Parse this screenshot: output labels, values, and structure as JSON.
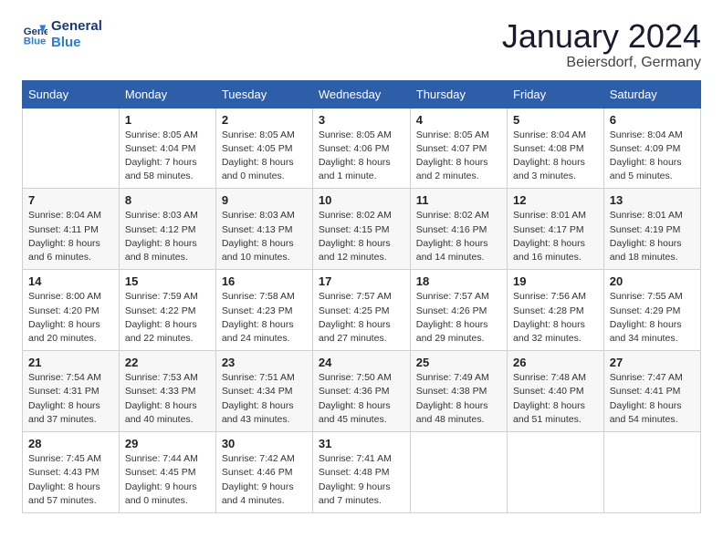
{
  "header": {
    "logo_line1": "General",
    "logo_line2": "Blue",
    "month": "January 2024",
    "location": "Beiersdorf, Germany"
  },
  "days_of_week": [
    "Sunday",
    "Monday",
    "Tuesday",
    "Wednesday",
    "Thursday",
    "Friday",
    "Saturday"
  ],
  "weeks": [
    [
      {
        "day": "",
        "info": ""
      },
      {
        "day": "1",
        "info": "Sunrise: 8:05 AM\nSunset: 4:04 PM\nDaylight: 7 hours\nand 58 minutes."
      },
      {
        "day": "2",
        "info": "Sunrise: 8:05 AM\nSunset: 4:05 PM\nDaylight: 8 hours\nand 0 minutes."
      },
      {
        "day": "3",
        "info": "Sunrise: 8:05 AM\nSunset: 4:06 PM\nDaylight: 8 hours\nand 1 minute."
      },
      {
        "day": "4",
        "info": "Sunrise: 8:05 AM\nSunset: 4:07 PM\nDaylight: 8 hours\nand 2 minutes."
      },
      {
        "day": "5",
        "info": "Sunrise: 8:04 AM\nSunset: 4:08 PM\nDaylight: 8 hours\nand 3 minutes."
      },
      {
        "day": "6",
        "info": "Sunrise: 8:04 AM\nSunset: 4:09 PM\nDaylight: 8 hours\nand 5 minutes."
      }
    ],
    [
      {
        "day": "7",
        "info": "Sunrise: 8:04 AM\nSunset: 4:11 PM\nDaylight: 8 hours\nand 6 minutes."
      },
      {
        "day": "8",
        "info": "Sunrise: 8:03 AM\nSunset: 4:12 PM\nDaylight: 8 hours\nand 8 minutes."
      },
      {
        "day": "9",
        "info": "Sunrise: 8:03 AM\nSunset: 4:13 PM\nDaylight: 8 hours\nand 10 minutes."
      },
      {
        "day": "10",
        "info": "Sunrise: 8:02 AM\nSunset: 4:15 PM\nDaylight: 8 hours\nand 12 minutes."
      },
      {
        "day": "11",
        "info": "Sunrise: 8:02 AM\nSunset: 4:16 PM\nDaylight: 8 hours\nand 14 minutes."
      },
      {
        "day": "12",
        "info": "Sunrise: 8:01 AM\nSunset: 4:17 PM\nDaylight: 8 hours\nand 16 minutes."
      },
      {
        "day": "13",
        "info": "Sunrise: 8:01 AM\nSunset: 4:19 PM\nDaylight: 8 hours\nand 18 minutes."
      }
    ],
    [
      {
        "day": "14",
        "info": "Sunrise: 8:00 AM\nSunset: 4:20 PM\nDaylight: 8 hours\nand 20 minutes."
      },
      {
        "day": "15",
        "info": "Sunrise: 7:59 AM\nSunset: 4:22 PM\nDaylight: 8 hours\nand 22 minutes."
      },
      {
        "day": "16",
        "info": "Sunrise: 7:58 AM\nSunset: 4:23 PM\nDaylight: 8 hours\nand 24 minutes."
      },
      {
        "day": "17",
        "info": "Sunrise: 7:57 AM\nSunset: 4:25 PM\nDaylight: 8 hours\nand 27 minutes."
      },
      {
        "day": "18",
        "info": "Sunrise: 7:57 AM\nSunset: 4:26 PM\nDaylight: 8 hours\nand 29 minutes."
      },
      {
        "day": "19",
        "info": "Sunrise: 7:56 AM\nSunset: 4:28 PM\nDaylight: 8 hours\nand 32 minutes."
      },
      {
        "day": "20",
        "info": "Sunrise: 7:55 AM\nSunset: 4:29 PM\nDaylight: 8 hours\nand 34 minutes."
      }
    ],
    [
      {
        "day": "21",
        "info": "Sunrise: 7:54 AM\nSunset: 4:31 PM\nDaylight: 8 hours\nand 37 minutes."
      },
      {
        "day": "22",
        "info": "Sunrise: 7:53 AM\nSunset: 4:33 PM\nDaylight: 8 hours\nand 40 minutes."
      },
      {
        "day": "23",
        "info": "Sunrise: 7:51 AM\nSunset: 4:34 PM\nDaylight: 8 hours\nand 43 minutes."
      },
      {
        "day": "24",
        "info": "Sunrise: 7:50 AM\nSunset: 4:36 PM\nDaylight: 8 hours\nand 45 minutes."
      },
      {
        "day": "25",
        "info": "Sunrise: 7:49 AM\nSunset: 4:38 PM\nDaylight: 8 hours\nand 48 minutes."
      },
      {
        "day": "26",
        "info": "Sunrise: 7:48 AM\nSunset: 4:40 PM\nDaylight: 8 hours\nand 51 minutes."
      },
      {
        "day": "27",
        "info": "Sunrise: 7:47 AM\nSunset: 4:41 PM\nDaylight: 8 hours\nand 54 minutes."
      }
    ],
    [
      {
        "day": "28",
        "info": "Sunrise: 7:45 AM\nSunset: 4:43 PM\nDaylight: 8 hours\nand 57 minutes."
      },
      {
        "day": "29",
        "info": "Sunrise: 7:44 AM\nSunset: 4:45 PM\nDaylight: 9 hours\nand 0 minutes."
      },
      {
        "day": "30",
        "info": "Sunrise: 7:42 AM\nSunset: 4:46 PM\nDaylight: 9 hours\nand 4 minutes."
      },
      {
        "day": "31",
        "info": "Sunrise: 7:41 AM\nSunset: 4:48 PM\nDaylight: 9 hours\nand 7 minutes."
      },
      {
        "day": "",
        "info": ""
      },
      {
        "day": "",
        "info": ""
      },
      {
        "day": "",
        "info": ""
      }
    ]
  ]
}
